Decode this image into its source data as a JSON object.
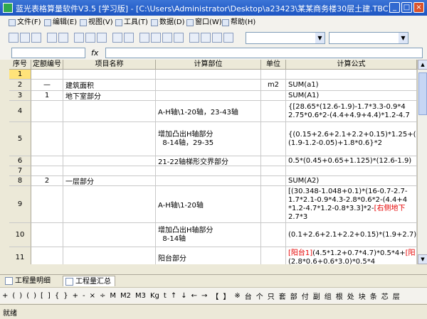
{
  "window": {
    "title": "蓝光表格算量软件V3.5 [学习版] - [C:\\Users\\Administrator\\Desktop\\a23423\\某某商务楼30层土建.TBC]",
    "controls": [
      "_",
      "□",
      "×"
    ]
  },
  "menu": [
    {
      "label": "文件(F)"
    },
    {
      "label": "编辑(E)"
    },
    {
      "label": "视图(V)"
    },
    {
      "label": "工具(T)"
    },
    {
      "label": "数据(D)"
    },
    {
      "label": "窗口(W)"
    },
    {
      "label": "帮助(H)"
    }
  ],
  "formula_bar": {
    "fx": "fx"
  },
  "grid": {
    "headers": [
      "序号",
      "定额编号",
      "项目名称",
      "计算部位",
      "单位",
      "计算公式"
    ],
    "rows": [
      {
        "no": "1",
        "code": "",
        "name": "",
        "part": "",
        "unit": "",
        "formula": []
      },
      {
        "no": "2",
        "code": "—",
        "name": "建筑面积",
        "part": "",
        "unit": "m2",
        "formula": [
          [
            {
              "t": "SUM(a1)"
            }
          ]
        ]
      },
      {
        "no": "3",
        "code": "1",
        "name": "地下室部分",
        "part": "",
        "unit": "",
        "formula": [
          [
            {
              "t": "SUM(A1)"
            }
          ]
        ]
      },
      {
        "no": "4",
        "code": "",
        "name": "",
        "part": "A-H轴\\1-20轴，23-43轴",
        "unit": "",
        "formula": [
          [
            {
              "t": "{[28.65*(12.6-1.9)-1.7*3.3-0.9*4"
            }
          ],
          [
            {
              "t": "2.75*0.6*2-(4.4+4.9+4.4)*1.2-4.7"
            }
          ]
        ]
      },
      {
        "no": "5",
        "code": "",
        "name": "",
        "part": "增加凸出H轴部分\n  8-14轴，29-35",
        "unit": "",
        "formula": [
          [
            {
              "t": "{(0.15+2.6+2.1+2.2+0.15)*1.25+(2"
            }
          ],
          [
            {
              "t": "(1.9-1.2-0.05)+1.8*0.6}*2"
            }
          ]
        ]
      },
      {
        "no": "6",
        "code": "",
        "name": "",
        "part": "21-22轴梯形交界部分",
        "unit": "",
        "formula": [
          [
            {
              "t": "0.5*(0.45+0.65+1.125)*(12.6-1.9)"
            }
          ]
        ]
      },
      {
        "no": "7",
        "code": "",
        "name": "",
        "part": "",
        "unit": "",
        "formula": []
      },
      {
        "no": "8",
        "code": "2",
        "name": "一层部分",
        "part": "",
        "unit": "",
        "formula": [
          [
            {
              "t": "SUM(A2)"
            }
          ]
        ]
      },
      {
        "no": "9",
        "code": "",
        "name": "",
        "part": "A-H轴\\1-20轴",
        "unit": "",
        "formula": [
          [
            {
              "t": "[(30.348-1.048+0.1)*(16-0.7-2.7-"
            }
          ],
          [
            {
              "t": "1.7*2.1-0.9*4.3-2.8*0.6*2-(4.4+4"
            }
          ],
          [
            {
              "t": "*1.2-4.7*1.2-0.8*3.3]*2-"
            },
            {
              "t": "[右侧地下",
              "red": true
            }
          ],
          [
            {
              "t": "2.7*3"
            }
          ]
        ]
      },
      {
        "no": "10",
        "code": "",
        "name": "",
        "part": "增加凸出H轴部分\n  8-14轴",
        "unit": "",
        "formula": [
          [
            {
              "t": "(0.1+2.6+2.1+2.2+0.15)*(1.9+2.7)"
            }
          ]
        ]
      },
      {
        "no": "11",
        "code": "",
        "name": "",
        "part": "阳台部分",
        "unit": "",
        "formula": [
          [
            {
              "t": "[阳台1]",
              "red": true
            },
            {
              "t": "(4.5*1.2+0.7*4.7)*0.5*4+"
            },
            {
              "t": "[阳",
              "red": true
            }
          ],
          [
            {
              "t": "(2.8*0.6+0.6*3.0)*0.5*4"
            }
          ]
        ]
      }
    ]
  },
  "sheet_tabs": [
    {
      "label": "工程量明细"
    },
    {
      "label": "工程量汇总"
    }
  ],
  "symbols": [
    "+",
    "(",
    ")",
    "(",
    ")",
    "[",
    "]",
    "{",
    "}",
    "+",
    "-",
    "×",
    "÷",
    "M",
    "M2",
    "M3",
    "Kg",
    "t",
    "↑",
    "↓",
    "←",
    "→",
    "【",
    "】",
    "※",
    "台",
    "个",
    "只",
    "套",
    "部",
    "付",
    "副",
    "组",
    "根",
    "处",
    "块",
    "条",
    "芯",
    "层"
  ],
  "status": {
    "text": "就绪"
  }
}
